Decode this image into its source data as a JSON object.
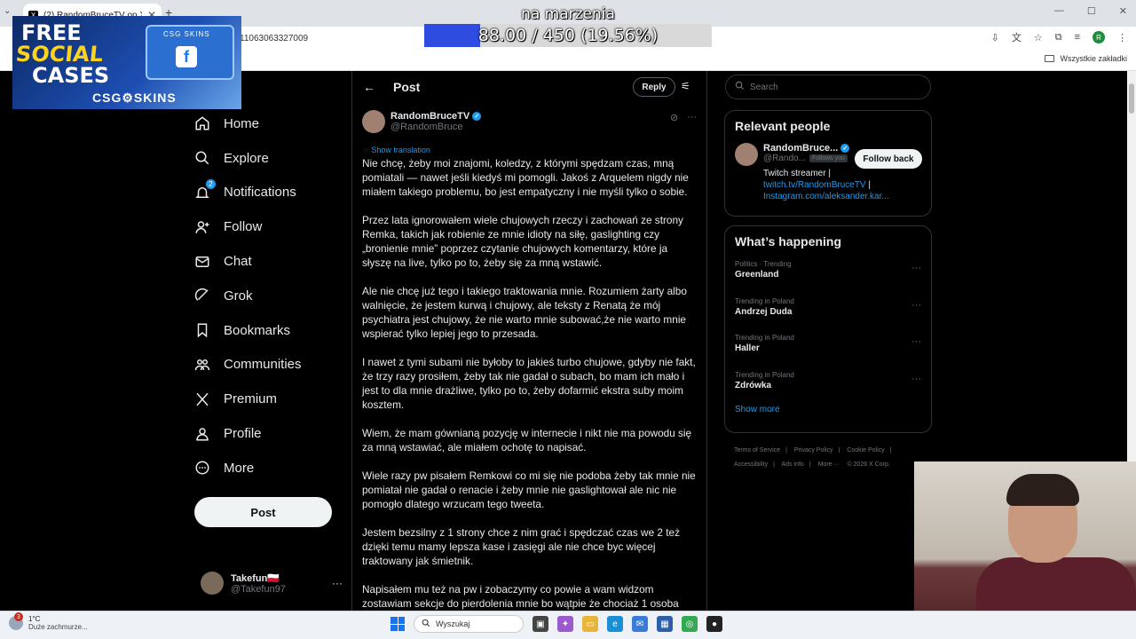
{
  "browser": {
    "tab_title": "(2) RandomBruceTV on X: \"Nie",
    "tab_close": "✕",
    "new_tab": "+",
    "address_fragment": "11063063327009",
    "profile_initial": "R",
    "bookmarks_folder": "Wszystkie zakładki"
  },
  "overlay": {
    "banner_line1": "FREE",
    "banner_line2": "SOCIAL",
    "banner_line3": "CASES",
    "banner_case_label": "CSG SKINS",
    "banner_brand": "CSG⚙SKINS",
    "goal_title": "na marzenia",
    "goal_text": "88.00 / 450 (19.56%)",
    "goal_fraction": 0.1956
  },
  "nav": {
    "items": [
      {
        "label": "Home",
        "icon": "home-icon"
      },
      {
        "label": "Explore",
        "icon": "search-icon"
      },
      {
        "label": "Notifications",
        "icon": "bell-icon",
        "badge": "2"
      },
      {
        "label": "Follow",
        "icon": "person-add-icon"
      },
      {
        "label": "Chat",
        "icon": "mail-icon"
      },
      {
        "label": "Grok",
        "icon": "grok-icon"
      },
      {
        "label": "Bookmarks",
        "icon": "bookmark-icon"
      },
      {
        "label": "Communities",
        "icon": "communities-icon"
      },
      {
        "label": "Premium",
        "icon": "x-logo-icon"
      },
      {
        "label": "Profile",
        "icon": "profile-icon"
      },
      {
        "label": "More",
        "icon": "more-circle-icon"
      }
    ],
    "post_button": "Post",
    "account_name": "Takefun🇵🇱",
    "account_handle": "@Takefun97"
  },
  "main": {
    "header_title": "Post",
    "reply_button": "Reply",
    "author_name": "RandomBruceTV",
    "author_handle": "@RandomBruce",
    "show_translation": "Show translation",
    "paragraphs": [
      "Nie chcę, żeby moi znajomi, koledzy, z którymi spędzam czas, mną pomiatali — nawet jeśli kiedyś mi pomogli. Jakoś z Arquelem nigdy nie miałem takiego problemu, bo jest empatyczny i nie myśli tylko o sobie.",
      "Przez lata ignorowałem wiele chujowych rzeczy i zachowań ze strony Remka, takich jak robienie ze mnie idioty na siłę, gaslighting czy „bronienie mnie” poprzez czytanie chujowych komentarzy, które ja słyszę na live, tylko po to, żeby się za mną wstawić.",
      "Ale nie chcę już tego i takiego traktowania mnie. Rozumiem żarty albo walnięcie, że jestem kurwą i chujowy, ale teksty z Renatą  że mój psychiatra jest chujowy, że nie warto mnie subować,że nie warto mnie wspierać tylko lepiej jego  to przesada.",
      "I nawet z tymi subami nie byłoby to jakieś turbo chujowe, gdyby nie fakt, że trzy razy prosiłem, żeby tak nie gadał o subach, bo mam ich mało i jest to dla mnie drażliwe, tylko po to, żeby dofarmić ekstra suby moim kosztem.",
      "Wiem, że mam gównianą pozycję w internecie i nikt nie ma powodu się za mną wstawiać, ale miałem ochotę to napisać.",
      "Wiele razy pw pisałem Remkowi co mi się nie podoba żeby tak mnie nie pomiatał nie gadał o renacie i żeby mnie nie gaslightował ale nic nie pomogło dlatego wrzucam tego tweeta.",
      "Jestem bezsilny z 1 strony chce z nim grać i spędczać czas we 2 też dzięki temu mamy lepsza kase i zasięgi ale nie chce byc więcej traktowany jak śmietnik.",
      "Napisałem mu też na pw i zobaczymy co powie a wam widzom zostawiam sekcje do pierdolenia mnie bo wątpie że chociaż 1 osoba"
    ]
  },
  "right": {
    "search_placeholder": "Search",
    "relevant_title": "Relevant people",
    "person_name": "RandomBruce...",
    "person_handle": "@Rando...",
    "follows_you": "Follows you",
    "follow_back": "Follow back",
    "bio_text": "Twitch streamer |",
    "bio_link1": "twitch.tv/RandomBruceTV",
    "bio_sep": " |",
    "bio_link2": "Instagram.com/aleksander.kar...",
    "happening_title": "What’s happening",
    "trends": [
      {
        "context": "Politics · Trending",
        "name": "Greenland"
      },
      {
        "context": "Trending in Poland",
        "name": "Andrzej Duda"
      },
      {
        "context": "Trending in Poland",
        "name": "Haller"
      },
      {
        "context": "Trending in Poland",
        "name": "Zdrówka"
      }
    ],
    "show_more": "Show more",
    "footer": [
      "Terms of Service",
      "|",
      "Privacy Policy",
      "|",
      "Cookie Policy",
      "|",
      "Accessibility",
      "|",
      "Ads info",
      "|",
      "More ···",
      "© 2026 X Corp."
    ]
  },
  "taskbar": {
    "weather_badge": "3",
    "temperature": "1°C",
    "weather_desc": "Duże zachmurze...",
    "search_label": "Wyszukaj"
  }
}
